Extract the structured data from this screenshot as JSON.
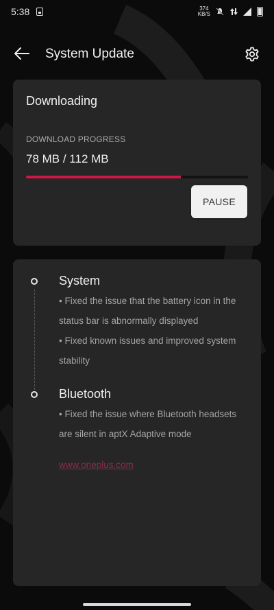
{
  "status_bar": {
    "time": "5:38",
    "net_speed_value": "374",
    "net_speed_unit": "KB/S"
  },
  "app_bar": {
    "title": "System Update",
    "back_icon": "arrow-left-icon",
    "settings_icon": "gear-icon"
  },
  "download": {
    "status": "Downloading",
    "progress_label": "DOWNLOAD PROGRESS",
    "progress_value": "78 MB / 112 MB",
    "progress_fraction": 0.696,
    "pause_label": "PAUSE"
  },
  "changelog": {
    "sections": [
      {
        "title": "System",
        "items": [
          "• Fixed the issue that the battery icon in the status bar is abnormally displayed",
          "• Fixed known issues and improved system stability"
        ]
      },
      {
        "title": "Bluetooth",
        "items": [
          "• Fixed the issue where Bluetooth headsets are silent in aptX Adaptive mode"
        ]
      }
    ],
    "link": "www.oneplus.com"
  },
  "colors": {
    "accent": "#d01649",
    "card_bg": "#262626",
    "page_bg": "#0b0b0b",
    "link": "#8a2e48"
  }
}
